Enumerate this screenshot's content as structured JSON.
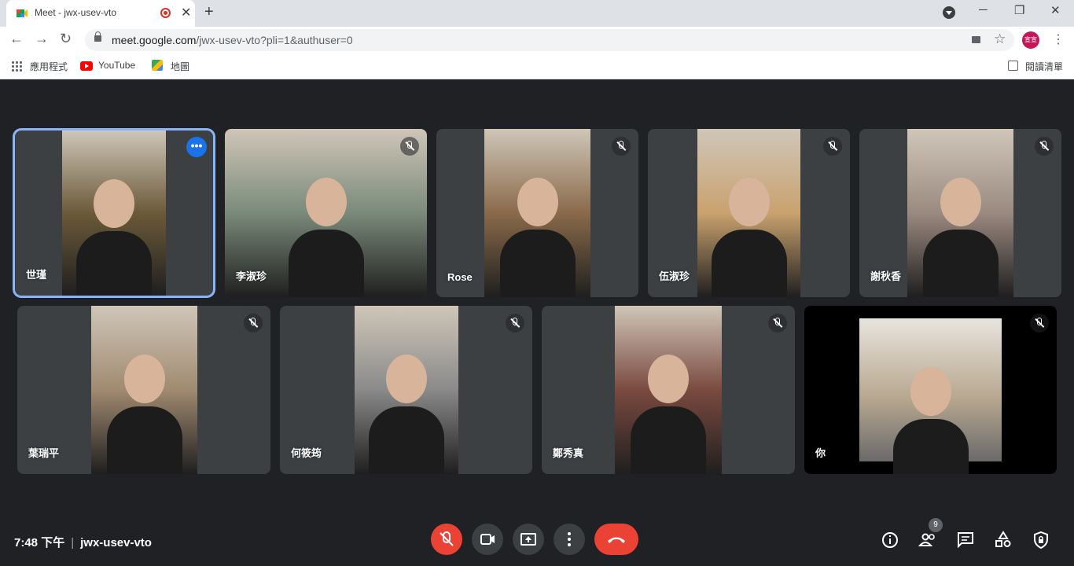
{
  "browser": {
    "tab_title": "Meet - jwx-usev-vto",
    "new_tab": "+",
    "url_host": "meet.google.com",
    "url_path": "/jwx-usev-vto?pli=1&authuser=0",
    "profile_initials": "宣宣",
    "bookmarks": {
      "apps": "應用程式",
      "youtube": "YouTube",
      "maps": "地圖",
      "reading_list": "閱讀清單"
    },
    "window_controls": {
      "minimize": "─",
      "restore": "❐",
      "close": "✕"
    }
  },
  "participants": [
    {
      "name": "世瑾",
      "muted": false,
      "active": true,
      "color": "#6b5a3a"
    },
    {
      "name": "李淑珍",
      "muted": true,
      "color": "#7a8a7a"
    },
    {
      "name": "Rose",
      "muted": true,
      "color": "#8a6a4a"
    },
    {
      "name": "伍淑珍",
      "muted": true,
      "color": "#c9a26e"
    },
    {
      "name": "謝秋香",
      "muted": true,
      "color": "#9a8a80"
    },
    {
      "name": "葉瑞平",
      "muted": true,
      "color": "#a08a70"
    },
    {
      "name": "何筱筠",
      "muted": true,
      "color": "#8a8a8a"
    },
    {
      "name": "鄭秀真",
      "muted": true,
      "color": "#7a4a40"
    },
    {
      "name": "你",
      "muted": true,
      "color": "#b8a890"
    }
  ],
  "footer": {
    "time": "7:48 下午",
    "separator": "|",
    "meeting_code": "jwx-usev-vto",
    "participant_count": "9"
  }
}
